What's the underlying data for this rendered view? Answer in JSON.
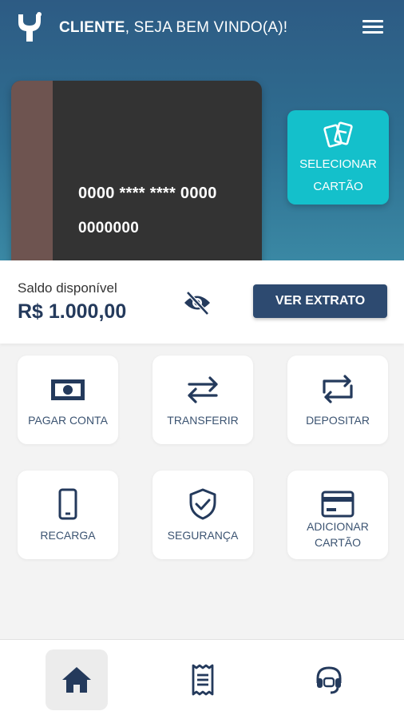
{
  "header": {
    "greeting_name": "CLIENTE",
    "greeting_rest": ", SEJA BEM VINDO(A)!",
    "logo_icon": "y-logo-icon",
    "menu_icon": "hamburger-menu-icon"
  },
  "card": {
    "number": "0000 **** **** 0000",
    "account": "0000000"
  },
  "select_card": {
    "line1": "SELECIONAR",
    "line2": "CARTÃO",
    "icon": "cards-icon"
  },
  "balance": {
    "label": "Saldo disponível",
    "value": "R$ 1.000,00",
    "toggle_icon": "eye-off-icon",
    "extract_button": "VER EXTRATO"
  },
  "actions": [
    {
      "label": "PAGAR CONTA",
      "icon": "cash-icon"
    },
    {
      "label": "TRANSFERIR",
      "icon": "swap-arrows-icon"
    },
    {
      "label": "DEPOSITAR",
      "icon": "repeat-icon"
    },
    {
      "label": "RECARGA",
      "icon": "phone-icon"
    },
    {
      "label": "SEGURANÇA",
      "icon": "shield-check-icon"
    },
    {
      "label_line1": "ADICIONAR",
      "label_line2": "CARTÃO",
      "icon": "credit-card-icon"
    }
  ],
  "bottom_nav": [
    {
      "name": "home",
      "icon": "home-icon",
      "active": true
    },
    {
      "name": "receipt",
      "icon": "receipt-icon",
      "active": false
    },
    {
      "name": "support",
      "icon": "headset-icon",
      "active": false
    }
  ],
  "colors": {
    "primary_dark": "#2d4a70",
    "accent_cyan": "#14c0cb",
    "icon_navy": "#243a5c"
  }
}
